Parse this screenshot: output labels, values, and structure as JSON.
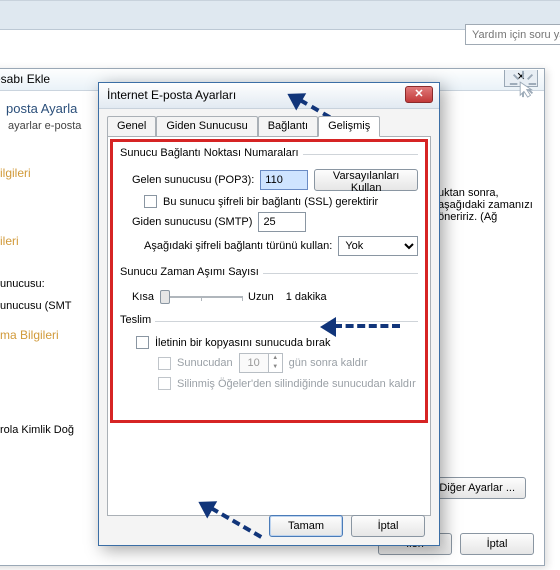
{
  "help": {
    "placeholder": "Yardım için soru ya"
  },
  "under": {
    "title": "esabı Ekle",
    "header": "posta Ayarla",
    "sub": "ayarlar e-posta",
    "sections": {
      "ilgileri": "ilgileri",
      "ileri": "ileri",
      "unucusu": "unucusu:",
      "unucusu_smt": "unucusu (SMT",
      "ma_bilgileri": "ma Bilgileri",
      "rola": "rola Kimlik Doğ"
    },
    "side_text": "uktan sonra, aşağıdaki zamanızı öneririz. (Ağ",
    "diger": "Diğer Ayarlar ...",
    "ileri_btn": "İleri",
    "iptal_btn": "İptal"
  },
  "dialog": {
    "title": "İnternet E-posta Ayarları",
    "tabs": {
      "genel": "Genel",
      "giden": "Giden Sunucusu",
      "baglanti": "Bağlantı",
      "gelismis": "Gelişmiş"
    },
    "groups": {
      "snn": "Sunucu Bağlantı Noktası Numaraları",
      "timeout": "Sunucu Zaman Aşımı Sayısı",
      "teslim": "Teslim"
    },
    "labels": {
      "gelen": "Gelen sunucusu (POP3):",
      "varsayilan": "Varsayılanları Kullan",
      "ssl": "Bu sunucu şifreli bir bağlantı (SSL) gerektirir",
      "giden": "Giden sunucusu (SMTP)",
      "sifreli": "Aşağıdaki şifreli bağlantı türünü kullan:",
      "kisa": "Kısa",
      "uzun": "Uzun",
      "dakika": "1 dakika",
      "kopya": "İletinin bir kopyasını sunucuda bırak",
      "sunucudan": "Sunucudan",
      "gunsonra": "gün sonra kaldır",
      "silinmis": "Silinmiş Öğeler'den silindiğinde sunucudan kaldır"
    },
    "values": {
      "pop3": "110",
      "smtp": "25",
      "encrypt": "Yok",
      "days": "10"
    },
    "buttons": {
      "tamam": "Tamam",
      "iptal": "İptal"
    }
  }
}
